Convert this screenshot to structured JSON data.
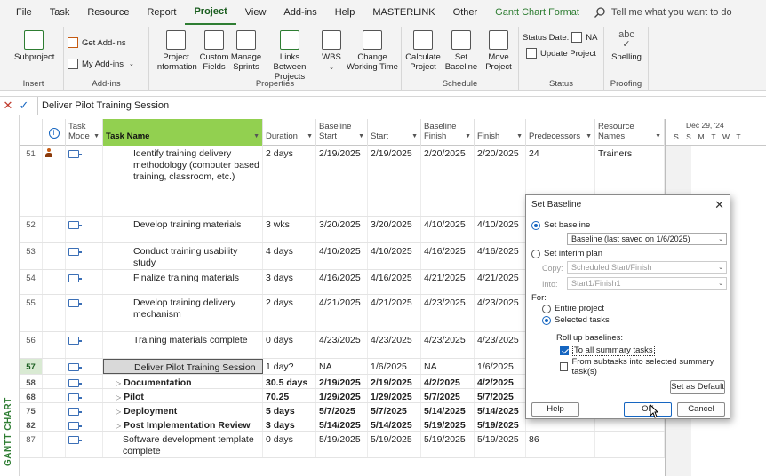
{
  "menu": {
    "tabs": [
      "File",
      "Task",
      "Resource",
      "Report",
      "Project",
      "View",
      "Add-ins",
      "Help",
      "MASTERLINK",
      "Other",
      "Gantt Chart Format"
    ],
    "active": "Project",
    "tell_me": "Tell me what you want to do"
  },
  "ribbon": {
    "insert": {
      "subproject": "Subproject",
      "label": "Insert"
    },
    "addins": {
      "get_addins": "Get Add-ins",
      "my_addins": "My Add-ins",
      "label": "Add-ins"
    },
    "properties": {
      "project_information": "Project Information",
      "custom_fields": "Custom Fields",
      "manage_sprints": "Manage Sprints",
      "links_between_projects": "Links Between Projects",
      "wbs": "WBS",
      "change_working_time": "Change Working Time",
      "label": "Properties"
    },
    "schedule": {
      "calculate_project": "Calculate Project",
      "set_baseline": "Set Baseline",
      "move_project": "Move Project",
      "label": "Schedule"
    },
    "status": {
      "status_date_label": "Status Date:",
      "status_date_value": "NA",
      "update_project": "Update Project",
      "label": "Status"
    },
    "proofing": {
      "spelling": "Spelling",
      "abc": "abc",
      "label": "Proofing"
    }
  },
  "entry_bar": {
    "value": "Deliver Pilot Training Session"
  },
  "side_label": "GANTT CHART",
  "columns": {
    "task_mode": "Task Mode",
    "task_name": "Task Name",
    "duration": "Duration",
    "baseline_start": "Baseline Start",
    "start": "Start",
    "baseline_finish": "Baseline Finish",
    "finish": "Finish",
    "predecessors": "Predecessors",
    "resource_names": "Resource Names"
  },
  "rows": [
    {
      "id": "51",
      "name": "Identify training delivery methodology (computer based training, classroom, etc.)",
      "duration": "2 days",
      "bstart": "2/19/2025",
      "start": "2/19/2025",
      "bfinish": "2/20/2025",
      "finish": "2/20/2025",
      "pred": "24",
      "res": "Trainers"
    },
    {
      "id": "52",
      "name": "Develop training materials",
      "duration": "3 wks",
      "bstart": "3/20/2025",
      "start": "3/20/2025",
      "bfinish": "4/10/2025",
      "finish": "4/10/2025",
      "pred": "",
      "res": ""
    },
    {
      "id": "53",
      "name": "Conduct training usability study",
      "duration": "4 days",
      "bstart": "4/10/2025",
      "start": "4/10/2025",
      "bfinish": "4/16/2025",
      "finish": "4/16/2025",
      "pred": "",
      "res": ""
    },
    {
      "id": "54",
      "name": "Finalize training materials",
      "duration": "3 days",
      "bstart": "4/16/2025",
      "start": "4/16/2025",
      "bfinish": "4/21/2025",
      "finish": "4/21/2025",
      "pred": "",
      "res": ""
    },
    {
      "id": "55",
      "name": "Develop training delivery mechanism",
      "duration": "2 days",
      "bstart": "4/21/2025",
      "start": "4/21/2025",
      "bfinish": "4/23/2025",
      "finish": "4/23/2025",
      "pred": "",
      "res": ""
    },
    {
      "id": "56",
      "name": "Training materials complete",
      "duration": "0 days",
      "bstart": "4/23/2025",
      "start": "4/23/2025",
      "bfinish": "4/23/2025",
      "finish": "4/23/2025",
      "pred": "",
      "res": ""
    },
    {
      "id": "57",
      "name": "Deliver Pilot Training Session",
      "duration": "1 day?",
      "bstart": "NA",
      "start": "1/6/2025",
      "bfinish": "NA",
      "finish": "1/6/2025",
      "pred": "",
      "res": ""
    },
    {
      "id": "58",
      "name": "Documentation",
      "duration": "30.5 days",
      "bstart": "2/19/2025",
      "start": "2/19/2025",
      "bfinish": "4/2/2025",
      "finish": "4/2/2025",
      "pred": "",
      "res": ""
    },
    {
      "id": "68",
      "name": "Pilot",
      "duration": "70.25 days",
      "bstart": "1/29/2025",
      "start": "1/29/2025",
      "bfinish": "5/7/2025",
      "finish": "5/7/2025",
      "pred": "",
      "res": ""
    },
    {
      "id": "75",
      "name": "Deployment",
      "duration": "5 days",
      "bstart": "5/7/2025",
      "start": "5/7/2025",
      "bfinish": "5/14/2025",
      "finish": "5/14/2025",
      "pred": "",
      "res": ""
    },
    {
      "id": "82",
      "name": "Post Implementation Review",
      "duration": "3 days",
      "bstart": "5/14/2025",
      "start": "5/14/2025",
      "bfinish": "5/19/2025",
      "finish": "5/19/2025",
      "pred": "",
      "res": ""
    },
    {
      "id": "87",
      "name": "Software development template complete",
      "duration": "0 days",
      "bstart": "5/19/2025",
      "start": "5/19/2025",
      "bfinish": "5/19/2025",
      "finish": "5/19/2025",
      "pred": "86",
      "res": ""
    }
  ],
  "timeline": {
    "week": "Dec 29, '24",
    "days": [
      "S",
      "S",
      "M",
      "T",
      "W",
      "T"
    ]
  },
  "dialog": {
    "title": "Set Baseline",
    "set_baseline": "Set baseline",
    "baseline_value": "Baseline (last saved on 1/6/2025)",
    "set_interim": "Set interim plan",
    "copy_label": "Copy:",
    "copy_value": "Scheduled Start/Finish",
    "into_label": "Into:",
    "into_value": "Start1/Finish1",
    "for_label": "For:",
    "entire_project": "Entire project",
    "selected_tasks": "Selected tasks",
    "rollup_label": "Roll up baselines:",
    "to_all_summary": "To all summary tasks",
    "from_subtasks": "From subtasks into selected summary task(s)",
    "set_default": "Set as Default",
    "help": "Help",
    "ok": "OK",
    "cancel": "Cancel"
  }
}
